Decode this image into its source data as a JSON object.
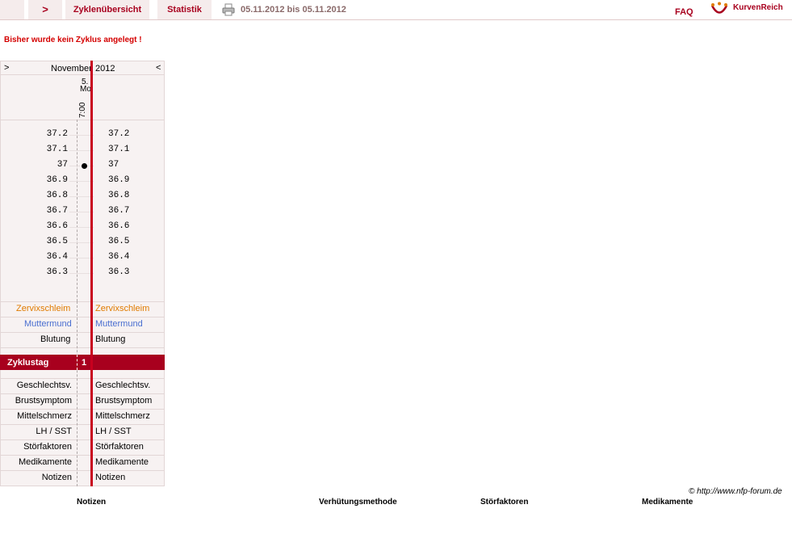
{
  "nav": {
    "arrow": ">",
    "tabs": [
      "Zyklenübersicht",
      "Statistik"
    ],
    "date_range": "05.11.2012 bis 05.11.2012",
    "faq": "FAQ",
    "brand": "KurvenReich"
  },
  "notice": "Bisher wurde kein Zyklus angelegt !",
  "calendar": {
    "prev": ">",
    "month": "November",
    "year": "2012",
    "next": "<",
    "day": "5.",
    "weekday": "Mo",
    "time": "7:00"
  },
  "temperatures": [
    "37.2",
    "37.1",
    "37",
    "36.9",
    "36.8",
    "36.7",
    "36.6",
    "36.5",
    "36.4",
    "36.3"
  ],
  "measurement": {
    "value": "37"
  },
  "rows_top": {
    "zervix": "Zervixschleim",
    "muttermund": "Muttermund",
    "blutung": "Blutung"
  },
  "zyklustag": {
    "label": "Zyklustag",
    "value": "1"
  },
  "rows_bottom": [
    "Geschlechtsv.",
    "Brustsymptom",
    "Mittelschmerz",
    "LH / SST",
    "Störfaktoren",
    "Medikamente",
    "Notizen"
  ],
  "copyright": "© http://www.nfp-forum.de",
  "footer": [
    "Notizen",
    "Verhütungsmethode",
    "Störfaktoren",
    "Medikamente"
  ],
  "colors": {
    "accent": "#a8001e",
    "zervix": "#e07b00",
    "muttermund": "#4a6fd0",
    "notice": "#d40000"
  }
}
